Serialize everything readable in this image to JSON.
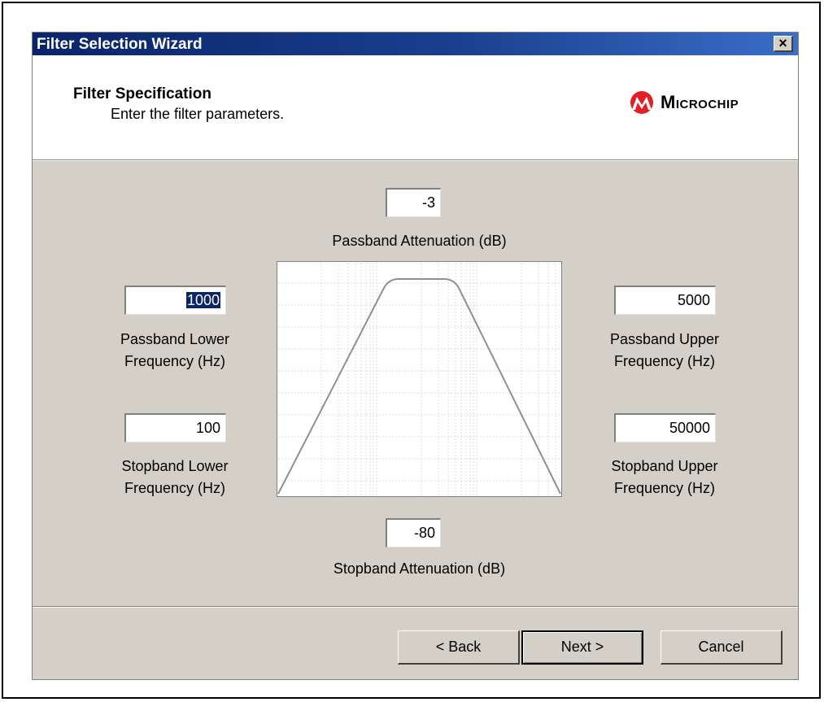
{
  "window": {
    "title": "Filter Selection Wizard",
    "close_label": "×"
  },
  "header": {
    "title": "Filter Specification",
    "subtitle": "Enter the filter parameters.",
    "logo_text": "Microchip",
    "logo_color": "#e41e26"
  },
  "params": {
    "passband_attenuation": {
      "value": "-3",
      "label": "Passband Attenuation (dB)"
    },
    "stopband_attenuation": {
      "value": "-80",
      "label": "Stopband Attenuation (dB)"
    },
    "passband_lower": {
      "value": "1000",
      "label_line1": "Passband Lower",
      "label_line2": "Frequency (Hz)"
    },
    "passband_upper": {
      "value": "5000",
      "label_line1": "Passband Upper",
      "label_line2": "Frequency (Hz)"
    },
    "stopband_lower": {
      "value": "100",
      "label_line1": "Stopband Lower",
      "label_line2": "Frequency (Hz)"
    },
    "stopband_upper": {
      "value": "50000",
      "label_line1": "Stopband Upper",
      "label_line2": "Frequency (Hz)"
    }
  },
  "buttons": {
    "back": "< Back",
    "next": "Next >",
    "cancel": "Cancel"
  },
  "colors": {
    "title_bar": "#0a246a",
    "dialog_bg": "#d4d0c8",
    "selection": "#0a246a",
    "curve": "#909090"
  }
}
